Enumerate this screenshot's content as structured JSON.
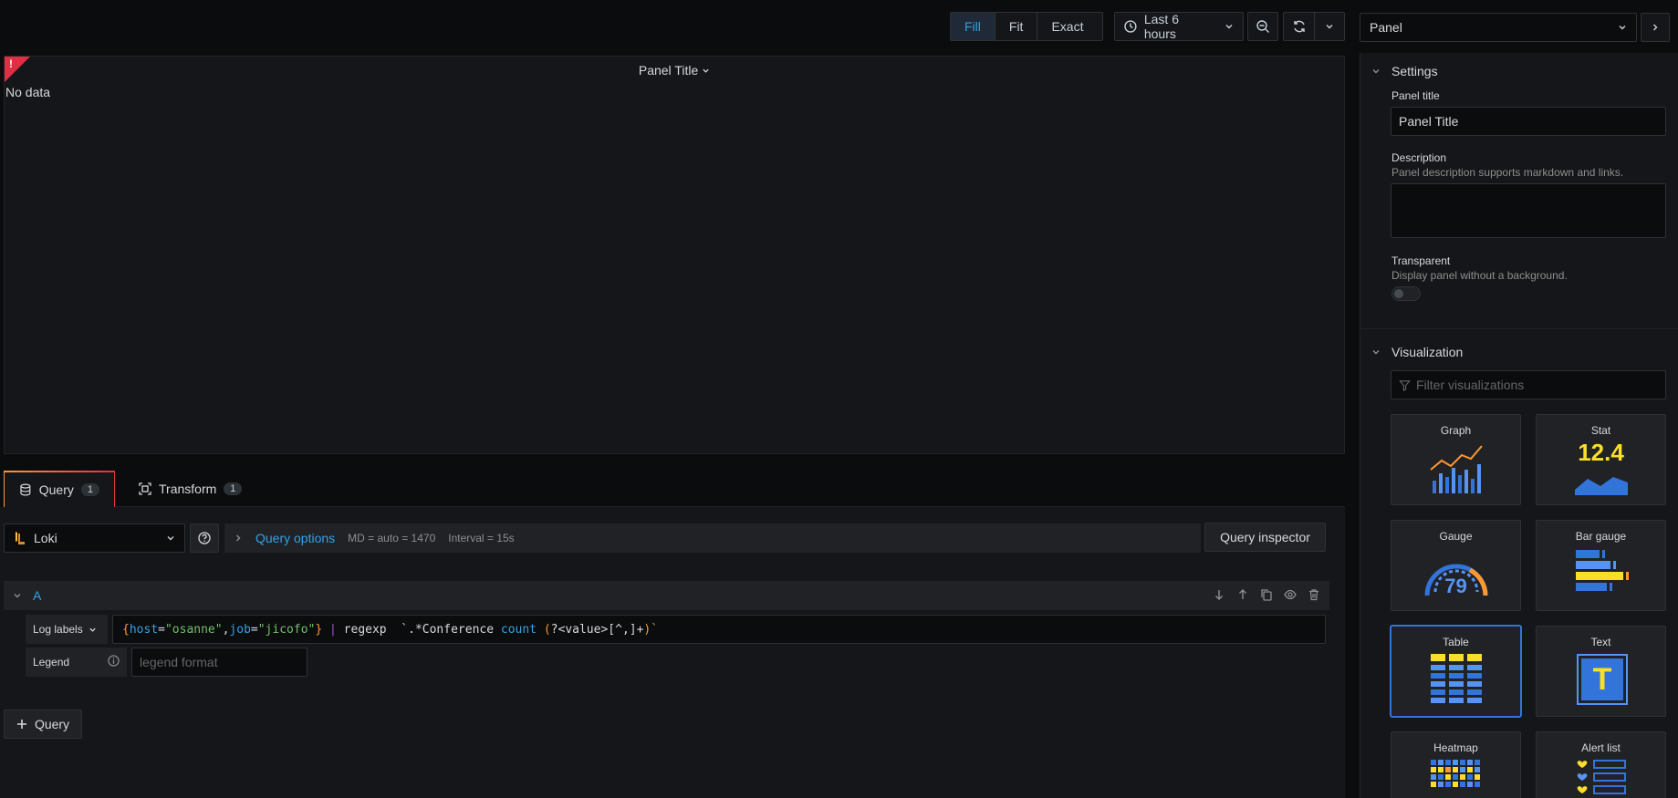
{
  "toolbar": {
    "fill_label": "Fill",
    "fit_label": "Fit",
    "exact_label": "Exact",
    "time_range": "Last 6 hours"
  },
  "panel": {
    "title": "Panel Title",
    "no_data": "No data",
    "error_badge": "!"
  },
  "tabs": [
    {
      "label": "Query",
      "count": "1"
    },
    {
      "label": "Transform",
      "count": "1"
    }
  ],
  "datasource": {
    "name": "Loki"
  },
  "query_options": {
    "title": "Query options",
    "md": "MD = auto = 1470",
    "interval": "Interval = 15s",
    "inspector_label": "Query inspector"
  },
  "query_a": {
    "ref": "A",
    "label_button": "Log labels",
    "expr_parts": {
      "p1": "{",
      "p2": "host",
      "p3": "=",
      "p4": "\"osanne\"",
      "p5": ",",
      "p6": "job",
      "p7": "=",
      "p8": "\"jicofo\"",
      "p9": "}",
      "p10": " | ",
      "p11": "regexp  ",
      "p12": "`.*Conference ",
      "p13": "count",
      "p14": " (",
      "p15": "?<value>[^,]+",
      "p16": ")`"
    },
    "legend_label": "Legend",
    "legend_placeholder": "legend format"
  },
  "add_query_label": "Query",
  "right": {
    "select_value": "Panel",
    "settings": {
      "title": "Settings",
      "panel_title_label": "Panel title",
      "panel_title_value": "Panel Title",
      "description_label": "Description",
      "description_desc": "Panel description supports markdown and links.",
      "transparent_label": "Transparent",
      "transparent_desc": "Display panel without a background."
    },
    "visualization": {
      "title": "Visualization",
      "filter_placeholder": "Filter visualizations",
      "items": [
        {
          "name": "Graph"
        },
        {
          "name": "Stat",
          "value": "12.4"
        },
        {
          "name": "Gauge",
          "value": "79"
        },
        {
          "name": "Bar gauge"
        },
        {
          "name": "Table"
        },
        {
          "name": "Text",
          "glyph": "T"
        },
        {
          "name": "Heatmap"
        },
        {
          "name": "Alert list"
        }
      ]
    }
  },
  "colors": {
    "accent_blue": "#33a2e5",
    "error_red": "#e02f44",
    "orange": "#ff9830",
    "yellow": "#fade2a",
    "viz_blue": "#3274d9",
    "green_string": "#73bf69"
  }
}
